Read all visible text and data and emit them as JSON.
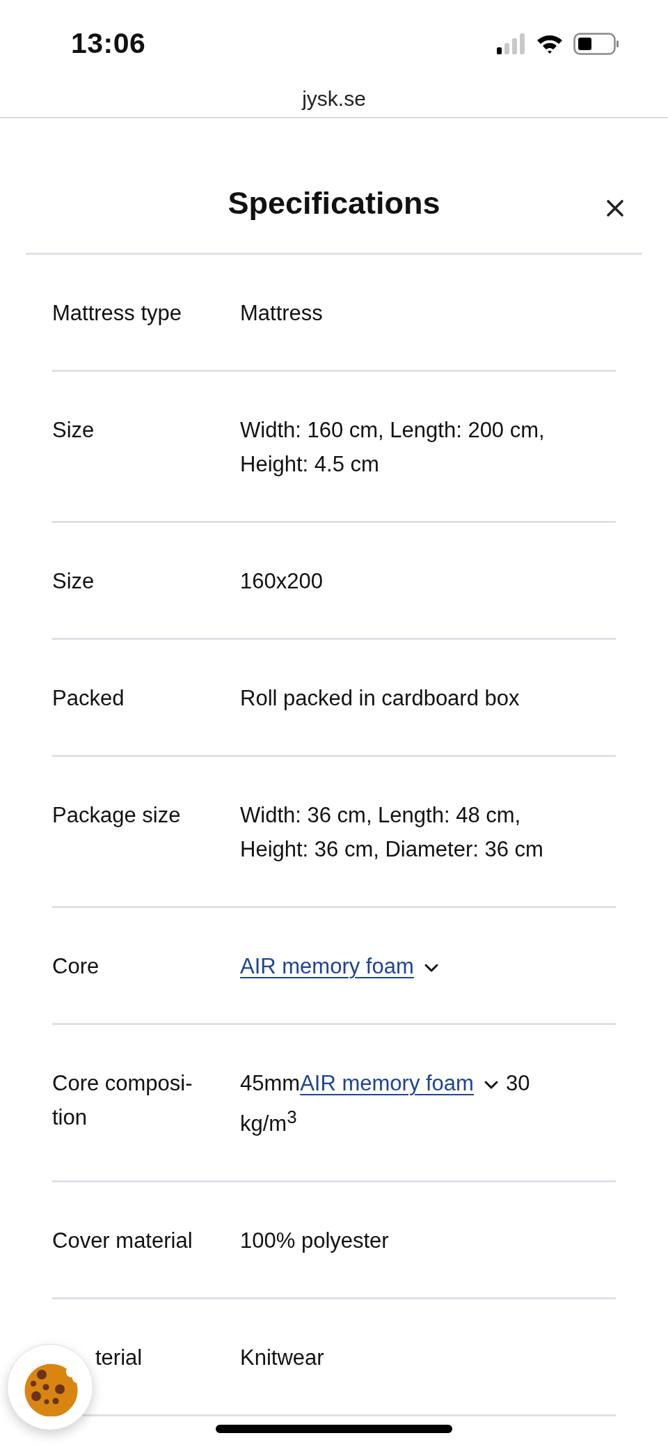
{
  "status_bar": {
    "time": "13:06"
  },
  "browser": {
    "url": "jysk.se"
  },
  "dialog": {
    "title": "Specifications"
  },
  "rows": [
    {
      "kind": "text",
      "label": "Mattress type",
      "value": "Mattress"
    },
    {
      "kind": "text",
      "label": "Size",
      "value": "Width: 160 cm, Length: 200 cm, Height: 4.5 cm"
    },
    {
      "kind": "text",
      "label": "Size",
      "value": "160x200"
    },
    {
      "kind": "text",
      "label": "Packed",
      "value": "Roll packed in cardboard box"
    },
    {
      "kind": "text",
      "label": "Package size",
      "value": "Width: 36 cm, Length: 48 cm, Height: 36 cm, Diameter: 36 cm"
    },
    {
      "kind": "parts",
      "label": "Core",
      "parts": [
        {
          "kind": "link",
          "text": "AIR memory foam",
          "expanded": false
        }
      ]
    },
    {
      "kind": "parts",
      "label": "Core composi-tion",
      "parts": [
        {
          "kind": "text",
          "text": "45mm"
        },
        {
          "kind": "link",
          "text": "AIR memory foam",
          "expanded": false
        },
        {
          "kind": "text",
          "text": "30"
        },
        {
          "kind": "text",
          "text": "kg/m$^{3}$"
        }
      ]
    },
    {
      "kind": "text",
      "label": "Cover material",
      "value": "100% polyester"
    },
    {
      "kind": "text",
      "label": "terial",
      "value": "Knitwear"
    }
  ]
}
